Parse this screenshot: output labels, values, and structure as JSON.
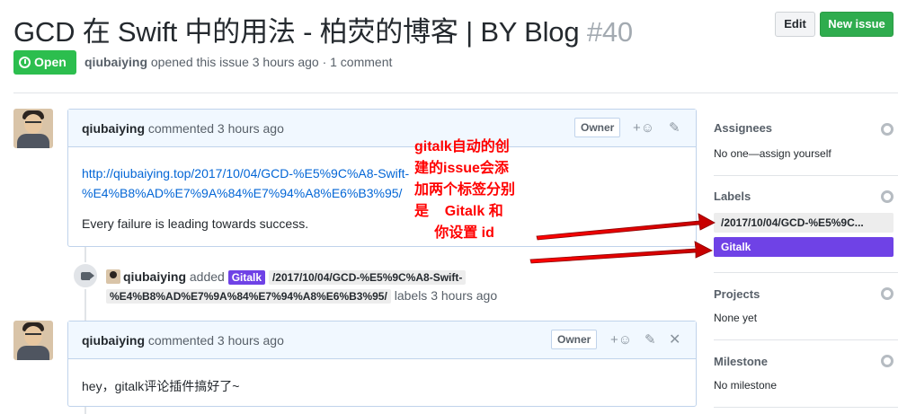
{
  "issue": {
    "title": "GCD 在 Swift 中的用法 - 柏荧的博客 | BY Blog",
    "number": "#40",
    "state": "Open",
    "author": "qiubaiying",
    "opened_text": "opened this issue 3 hours ago · 1 comment"
  },
  "header_buttons": {
    "edit": "Edit",
    "new_issue": "New issue"
  },
  "comments": [
    {
      "author": "qiubaiying",
      "meta": "commented 3 hours ago",
      "role": "Owner",
      "link_line1": "http://qiubaiying.top/2017/10/04/GCD-%E5%9C%A8-Swift-",
      "link_line2": "%E4%B8%AD%E7%9A%84%E7%94%A8%E6%B3%95/",
      "text": "Every failure is leading towards success."
    },
    {
      "author": "qiubaiying",
      "meta": "commented 3 hours ago",
      "role": "Owner",
      "text": "hey，gitalk评论插件搞好了~"
    }
  ],
  "event": {
    "actor": "qiubaiying",
    "action": "added",
    "label_gitalk": "Gitalk",
    "label_path_line1": "/2017/10/04/GCD-%E5%9C%A8-Swift-",
    "label_path_line2": "%E4%B8%AD%E7%9A%84%E7%94%A8%E6%B3%95/",
    "suffix": "labels 3 hours ago"
  },
  "sidebar": {
    "assignees": {
      "title": "Assignees",
      "value": "No one—assign yourself"
    },
    "labels": {
      "title": "Labels",
      "items": [
        "/2017/10/04/GCD-%E5%9C...",
        "Gitalk"
      ]
    },
    "projects": {
      "title": "Projects",
      "value": "None yet"
    },
    "milestone": {
      "title": "Milestone",
      "value": "No milestone"
    }
  },
  "annotation": {
    "lines": [
      "gitalk自动的创",
      "建的issue会添",
      "加两个标签分别",
      "是    Gitalk 和",
      "     你设置 id"
    ]
  },
  "colors": {
    "open_green": "#2cbe4e",
    "new_issue_green": "#2fac4e",
    "gitalk_label": "#6f42e6",
    "path_label": "#ededed",
    "annotation_red": "#ff0000",
    "comment_header_bg": "#f1f8ff"
  },
  "icons": [
    "alert-circle-icon",
    "emoji-icon",
    "pencil-icon",
    "close-icon",
    "tag-icon",
    "gear-icon",
    "avatar"
  ]
}
